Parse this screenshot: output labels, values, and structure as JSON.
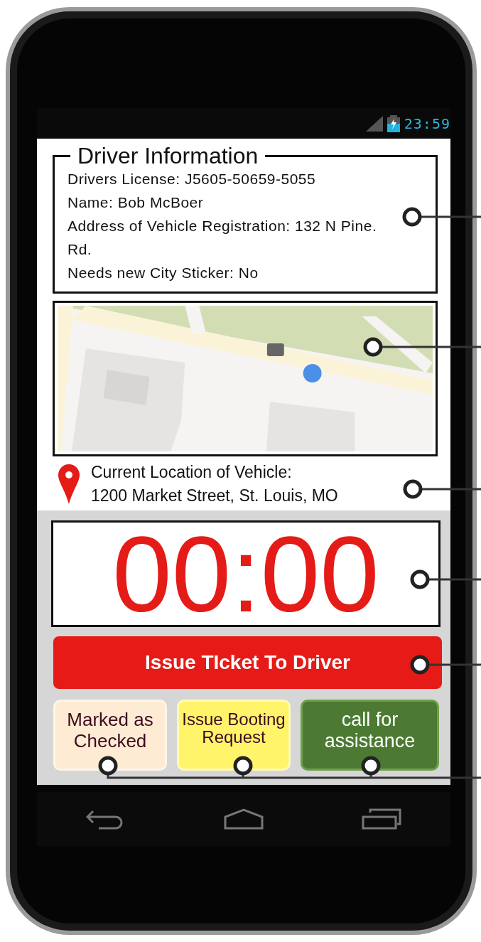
{
  "status_bar": {
    "time": "23:59"
  },
  "driver_info": {
    "title": "Driver Information",
    "lines": [
      "Drivers License: J5605-50659-5055",
      "Name: Bob McBoer",
      "Address of Vehicle Registration: 132 N Pine. Rd.",
      "Needs new City Sticker: No"
    ]
  },
  "location": {
    "label": "Current Location of Vehicle:",
    "address": "1200 Market Street, St. Louis, MO"
  },
  "timer": {
    "value": "00:00"
  },
  "primary_button": {
    "label": "Issue TIcket To Driver"
  },
  "actions": [
    {
      "label": "Marked as Checked",
      "color": "#fdebd3"
    },
    {
      "label": "Issue Booting Request",
      "color": "#fff46a"
    },
    {
      "label": "call for assistance",
      "color": "#4c7a33"
    }
  ]
}
